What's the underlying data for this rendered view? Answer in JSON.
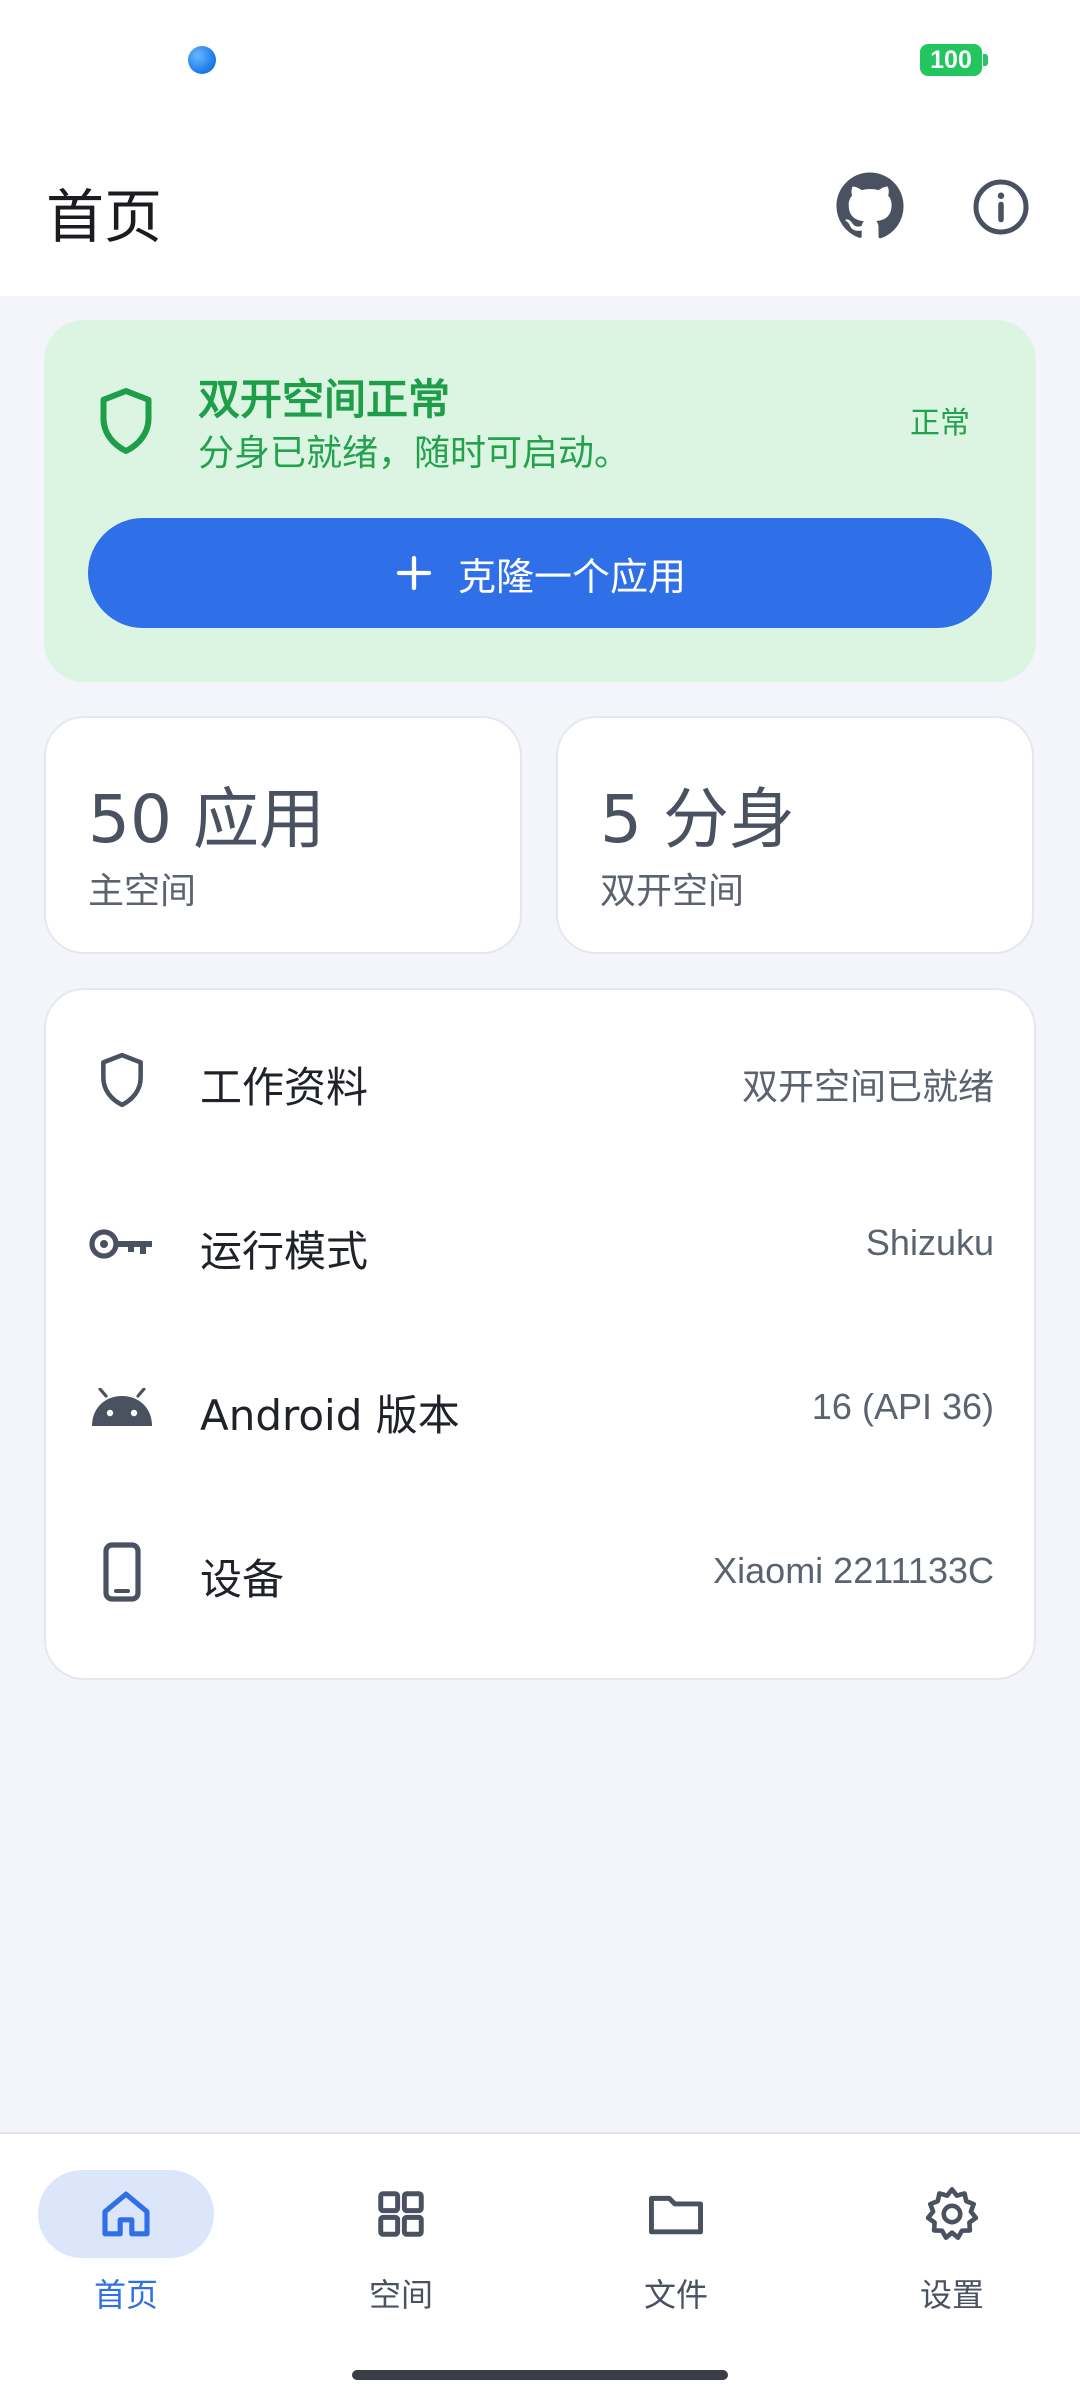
{
  "status_bar": {
    "battery": "100"
  },
  "app_bar": {
    "title": "首页"
  },
  "status_card": {
    "title": "双开空间正常",
    "subtitle": "分身已就绪，随时可启动。",
    "badge": "正常",
    "clone_button_label": "克隆一个应用"
  },
  "stats": [
    {
      "value": "50 应用",
      "label": "主空间"
    },
    {
      "value": "5 分身",
      "label": "双开空间"
    }
  ],
  "info_rows": [
    {
      "icon": "shield-icon",
      "label": "工作资料",
      "value": "双开空间已就绪"
    },
    {
      "icon": "key-icon",
      "label": "运行模式",
      "value": "Shizuku"
    },
    {
      "icon": "android-icon",
      "label": "Android 版本",
      "value": "16 (API 36)"
    },
    {
      "icon": "phone-icon",
      "label": "设备",
      "value": "Xiaomi 2211133C"
    }
  ],
  "nav": [
    {
      "icon": "home-icon",
      "label": "首页",
      "active": true
    },
    {
      "icon": "grid-icon",
      "label": "空间",
      "active": false
    },
    {
      "icon": "folder-icon",
      "label": "文件",
      "active": false
    },
    {
      "icon": "gear-icon",
      "label": "设置",
      "active": false
    }
  ],
  "colors": {
    "accent": "#2f6fe8",
    "success": "#1e9e48",
    "success_bg": "#dcf5e3",
    "background": "#f3f5fa"
  }
}
